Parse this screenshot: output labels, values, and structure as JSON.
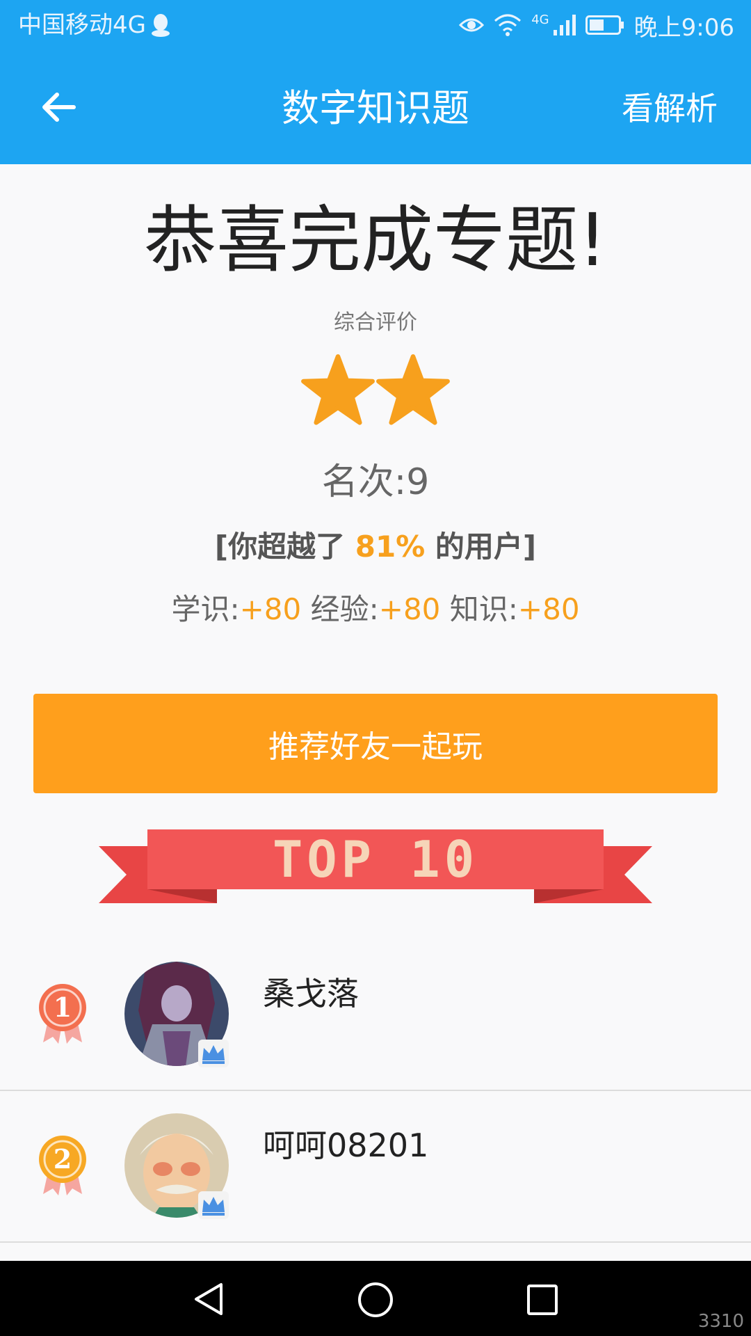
{
  "status": {
    "carrier": "中国移动4G",
    "network": "4G",
    "time": "晚上9:06"
  },
  "appbar": {
    "title": "数字知识题",
    "action": "看解析"
  },
  "result": {
    "headline": "恭喜完成专题!",
    "evaluation_label": "综合评价",
    "stars": 2,
    "rank_text": "名次:9",
    "surpass_prefix": "[你超越了 ",
    "surpass_percent": "81%",
    "surpass_suffix": " 的用户]",
    "gains": [
      {
        "label": "学识:",
        "value": "+80"
      },
      {
        "label": "经验:",
        "value": "+80"
      },
      {
        "label": "知识:",
        "value": "+80"
      }
    ]
  },
  "cta": {
    "label": "推荐好友一起玩"
  },
  "banner": {
    "text": "TOP 10"
  },
  "leaderboard": [
    {
      "rank": "1",
      "name": "桑戈落",
      "medal_color": "#f36f4f"
    },
    {
      "rank": "2",
      "name": "呵呵08201",
      "medal_color": "#f7a824"
    }
  ],
  "watermark": "3310",
  "colors": {
    "primary": "#1da5f2",
    "accent": "#ff9f1c",
    "star": "#f7a01d",
    "ribbon": "#ef5350"
  }
}
